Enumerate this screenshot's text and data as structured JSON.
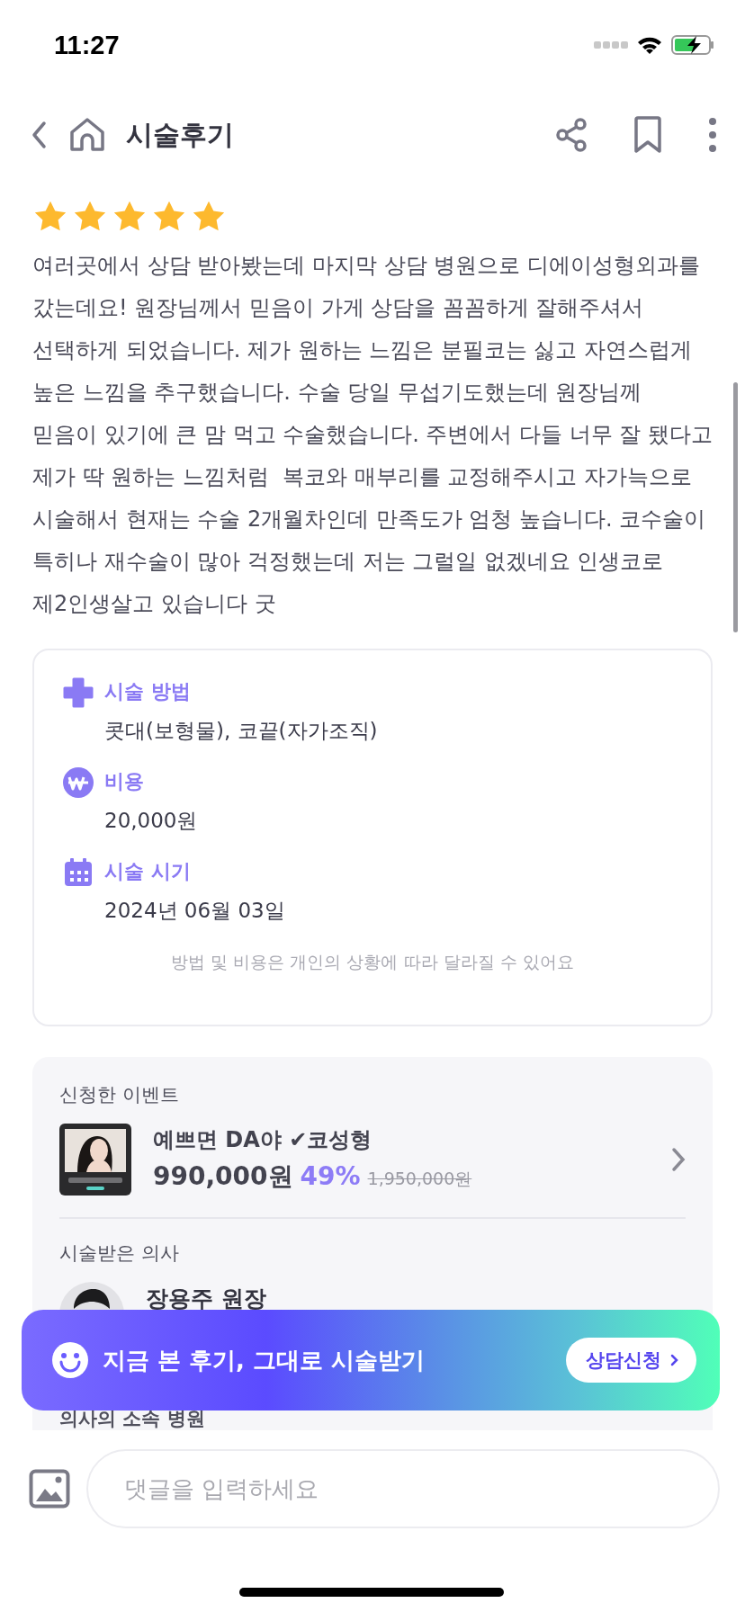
{
  "status_bar": {
    "time": "11:27"
  },
  "header": {
    "title": "시술후기"
  },
  "review": {
    "stars": 5,
    "text": "여러곳에서 상담 받아봤는데 마지막 상담 병원으로 디에이성형외과를 갔는데요! 원장님께서 믿음이 가게 상담을 꼼꼼하게 잘해주셔서 선택하게 되었습니다. 제가 원하는 느낌은 분필코는 싫고 자연스럽게 높은 느낌을 추구했습니다. 수술 당일 무섭기도했는데 원장님께 믿음이 있기에 큰 맘 먹고 수술했습니다. 주변에서 다들 너무 잘 됐다고 제가 딱 원하는 느낌처럼  복코와 매부리를 교정해주시고 자가늑으로 시술해서 현재는 수술 2개월차인데 만족도가 엄청 높습니다. 코수술이 특히나 재수술이 많아 걱정했는데 저는 그럴일 없겠네요 인생코로 제2인생살고 있습니다 굿"
  },
  "details": {
    "items": [
      {
        "kind": "method",
        "label": "시술 방법",
        "value": "콧대(보형물), 코끝(자가조직)"
      },
      {
        "kind": "cost",
        "label": "비용",
        "value": "20,000원"
      },
      {
        "kind": "date",
        "label": "시술 시기",
        "value": "2024년 06월 03일"
      }
    ],
    "note": "방법 및 비용은 개인의 상황에 따라 달라질 수 있어요"
  },
  "event": {
    "heading": "신청한 이벤트",
    "title": "예쁘면 DA야 ✔코성형",
    "price": "990,000원",
    "discount": "49%",
    "original_price": "1,950,000원"
  },
  "doctor": {
    "heading": "시술받은 의사",
    "name": "장용주 원장"
  },
  "hospital": {
    "heading": "의사의 소속 병원"
  },
  "banner": {
    "text": "지금 본 후기, 그대로 시술받기",
    "button": "상담신청"
  },
  "comment": {
    "placeholder": "댓글을 입력하세요"
  }
}
